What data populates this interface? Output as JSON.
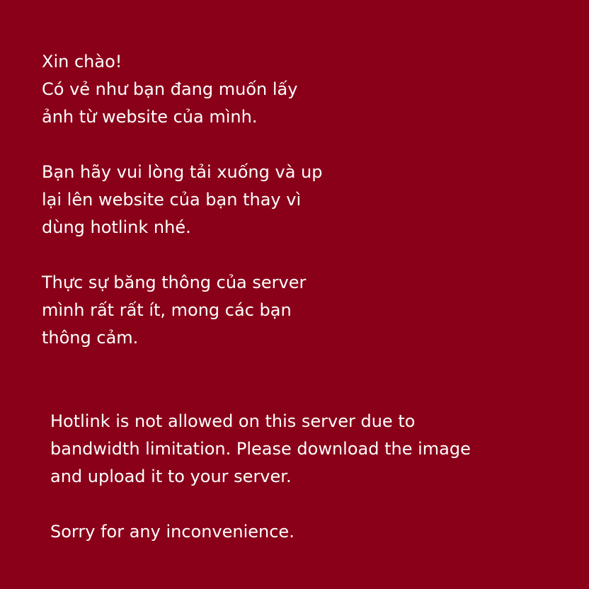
{
  "colors": {
    "background": "#8a0019",
    "text": "#ffffff"
  },
  "vietnamese": {
    "paragraphs": [
      [
        "Xin chào!",
        "Có vẻ như bạn đang muốn lấy",
        "ảnh từ website của mình."
      ],
      [
        "Bạn hãy vui lòng tải xuống và up",
        "lại lên website của bạn thay vì",
        "dùng hotlink nhé."
      ],
      [
        "Thực sự băng thông của server",
        "mình rất rất ít, mong các bạn",
        "thông cảm."
      ]
    ]
  },
  "english": {
    "paragraphs": [
      [
        "Hotlink is not allowed on this server due to",
        "bandwidth limitation. Please download the image",
        "and upload it to your server."
      ],
      [
        "Sorry for any inconvenience."
      ]
    ]
  }
}
